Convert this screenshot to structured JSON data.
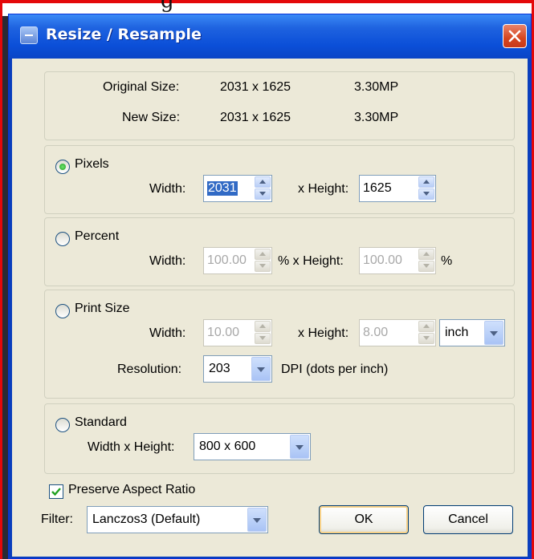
{
  "background_caption": "g",
  "dialog": {
    "title": "Resize / Resample",
    "size_info": {
      "original_label": "Original Size:",
      "original_dims": "2031 x 1625",
      "original_mp": "3.30MP",
      "new_label": "New Size:",
      "new_dims": "2031 x 1625",
      "new_mp": "3.30MP"
    },
    "pixels": {
      "radio_label": "Pixels",
      "selected": true,
      "width_label": "Width:",
      "width_value": "2031",
      "height_label": "x Height:",
      "height_value": "1625"
    },
    "percent": {
      "radio_label": "Percent",
      "selected": false,
      "width_label": "Width:",
      "width_value": "100.00",
      "width_unit": "%",
      "height_label": "% x Height:",
      "height_value": "100.00",
      "height_unit": "%"
    },
    "print_size": {
      "radio_label": "Print Size",
      "selected": false,
      "width_label": "Width:",
      "width_value": "10.00",
      "height_label": "x Height:",
      "height_value": "8.00",
      "unit_value": "inch",
      "resolution_label": "Resolution:",
      "resolution_value": "203",
      "resolution_unit": "DPI (dots per inch)"
    },
    "standard": {
      "radio_label": "Standard",
      "selected": false,
      "dims_label": "Width x Height:",
      "dims_value": "800 x 600"
    },
    "preserve_aspect": {
      "label": "Preserve Aspect Ratio",
      "checked": true
    },
    "filter": {
      "label": "Filter:",
      "value": "Lanczos3 (Default)"
    },
    "buttons": {
      "ok": "OK",
      "cancel": "Cancel"
    }
  },
  "colors": {
    "title_bar": "#0b4fd8",
    "close_button": "#d6451f",
    "dialog_bg": "#ece9d8",
    "selection": "#316ac5",
    "outer_frame": "#e4080a"
  }
}
